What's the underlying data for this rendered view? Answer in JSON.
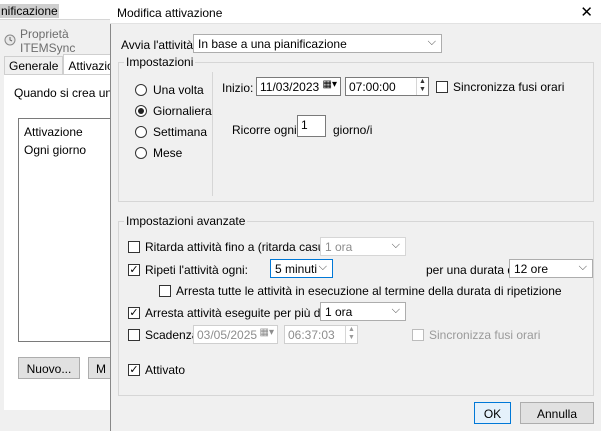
{
  "background_window": {
    "title_fragment": "nificazione",
    "properties_label": "Proprietà ITEMSync",
    "tabs": [
      "Generale",
      "Attivazione"
    ],
    "description": "Quando si crea un'att",
    "list_header": "Attivazione",
    "list_row": "Ogni giorno",
    "new_button": "Nuovo...",
    "modify_button_fragment": "M"
  },
  "dialog": {
    "title": "Modifica attivazione",
    "close_glyph": "✕",
    "start_label": "Avvia l'attività:",
    "start_value": "In base a una pianificazione",
    "settings_group": "Impostazioni",
    "radios": [
      "Una volta",
      "Giornaliera",
      "Settimana",
      "Mese"
    ],
    "selected_radio": "Giornaliera",
    "start": {
      "label": "Inizio:",
      "date": "11/03/2023",
      "time": "07:00:00",
      "sync_label": "Sincronizza fusi orari"
    },
    "recur": {
      "label": "Ricorre ogni:",
      "value": "1",
      "unit": "giorno/i"
    },
    "advanced_group": "Impostazioni avanzate",
    "delay": {
      "label": "Ritarda attività fino a (ritarda casuale):",
      "value": "1 ora",
      "checked": false
    },
    "repeat": {
      "label": "Ripeti l'attività ogni:",
      "value": "5 minuti",
      "checked": true,
      "duration_label": "per una durata di:",
      "duration_value": "12 ore",
      "stop_label": "Arresta tutte le attività in esecuzione al termine della durata di ripetizione"
    },
    "stop_long": {
      "label": "Arresta attività eseguite per più di:",
      "value": "1 ora",
      "checked": true
    },
    "expire": {
      "label": "Scadenza:",
      "date": "03/05/2025",
      "time": "06:37:03",
      "sync_label": "Sincronizza fusi orari",
      "checked": false
    },
    "enabled": {
      "label": "Attivato",
      "checked": true
    },
    "ok_label": "OK",
    "cancel_label": "Annulla"
  },
  "colors": {
    "accent": "#0078d7",
    "window_bg": "#f0f0f0"
  }
}
